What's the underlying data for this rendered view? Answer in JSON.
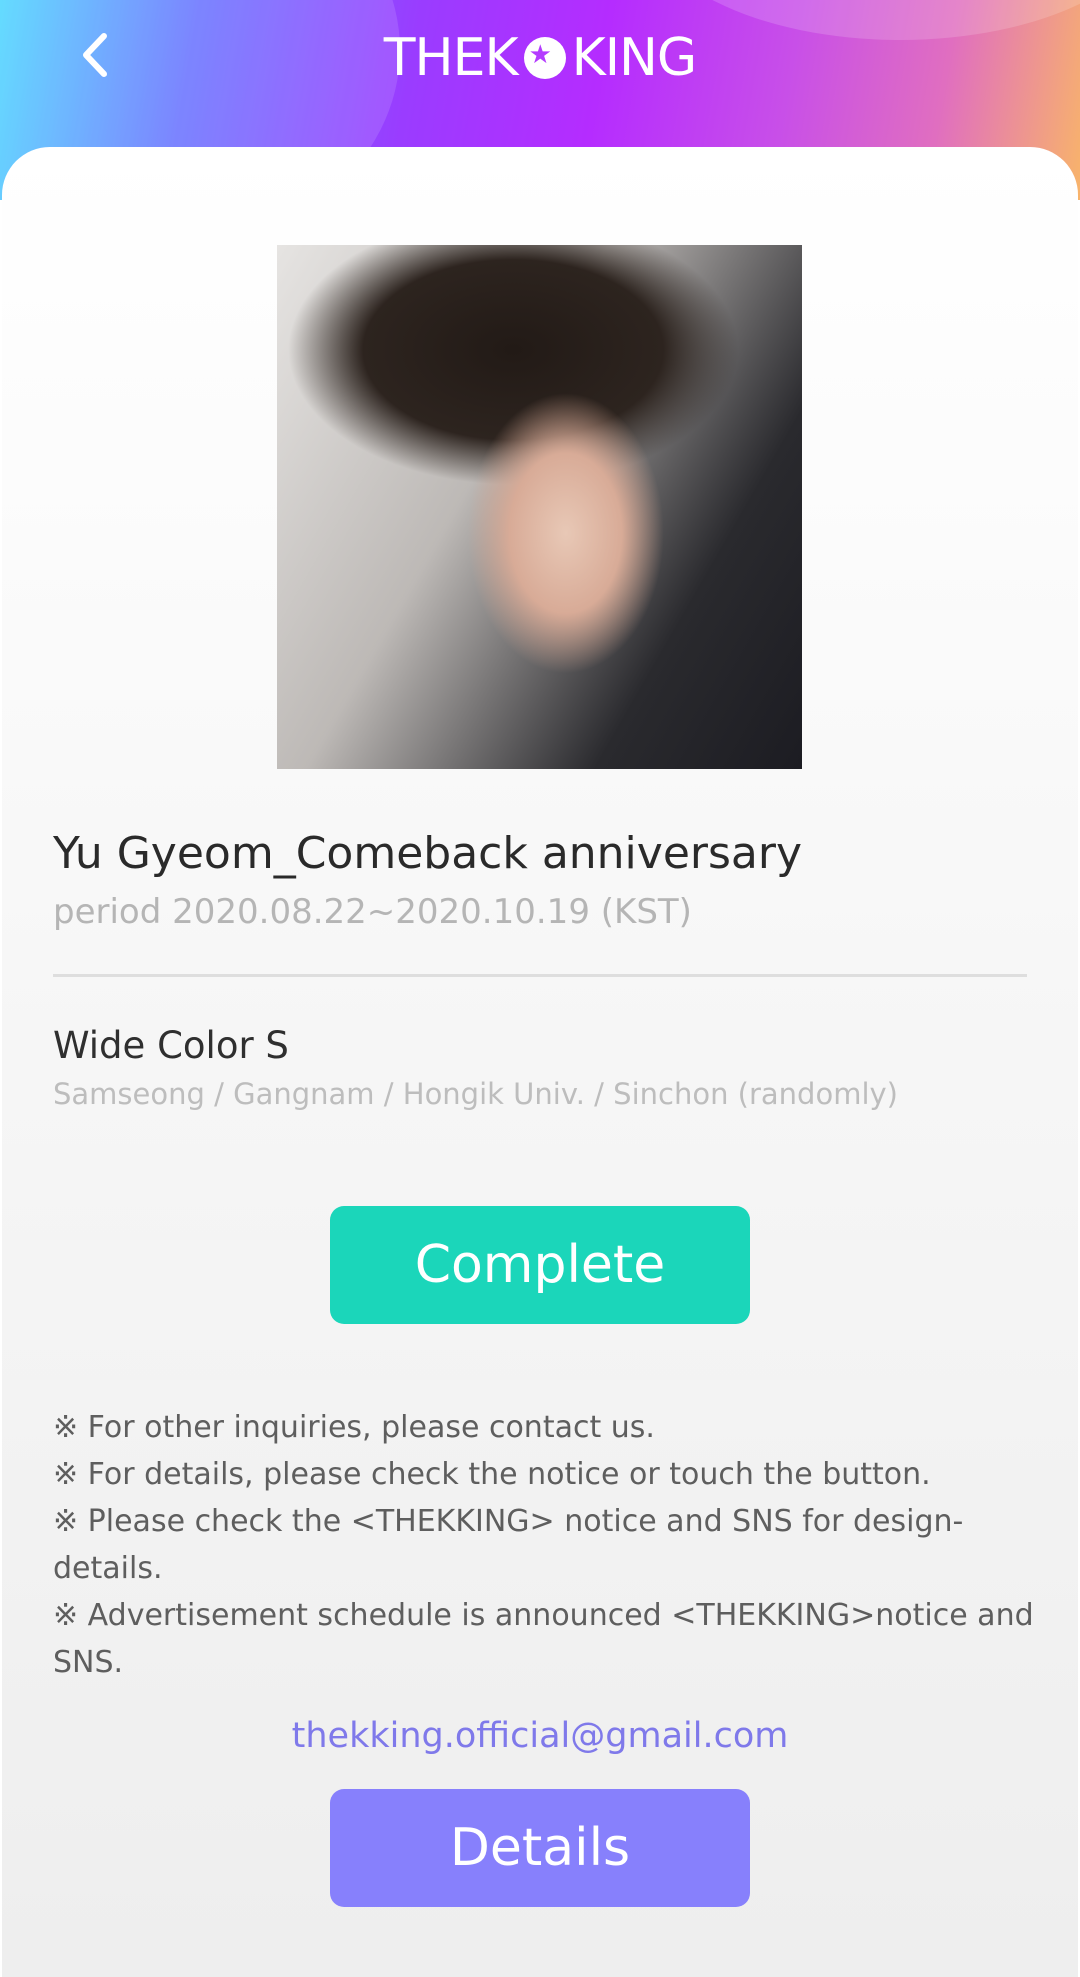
{
  "header": {
    "logo_left": "THEK",
    "logo_right": "KING",
    "back_icon": "chevron-left-icon"
  },
  "campaign": {
    "title": "Yu Gyeom_Comeback anniversary",
    "period": "period 2020.08.22~2020.10.19 (KST)",
    "photo_alt": "artist-photo"
  },
  "option": {
    "name": "Wide Color S",
    "locations": "Samseong / Gangnam / Hongik Univ. / Sinchon (randomly)"
  },
  "buttons": {
    "complete_label": "Complete",
    "details_label": "Details"
  },
  "notes": [
    "※ For other inquiries, please contact us.",
    "※ For details, please check the notice or touch the button.",
    "※ Please check the <THEKKING> notice and SNS for design-details.",
    "※ Advertisement schedule is announced <THEKKING>notice and SNS."
  ],
  "contact": {
    "email": "thekking.official@gmail.com"
  },
  "colors": {
    "complete_button": "#1bd6ba",
    "details_button": "#8780fc",
    "email_text": "#7f79ea"
  }
}
